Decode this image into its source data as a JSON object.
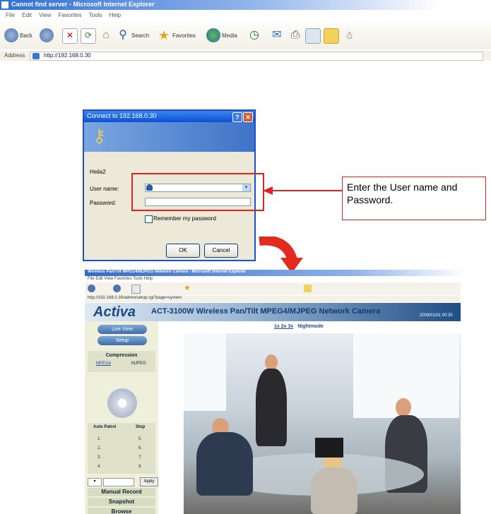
{
  "ie": {
    "title": "Cannot find server - Microsoft Internet Explorer",
    "menu": [
      "File",
      "Edit",
      "View",
      "Favorites",
      "Tools",
      "Help"
    ],
    "toolbar": {
      "back": "Back",
      "search": "Search",
      "favorites": "Favorites",
      "media": "Media"
    },
    "address_label": "Address",
    "address_value": "http://192.168.0.30"
  },
  "login": {
    "title": "Connect to 192.168.0.30",
    "realm": "Heila2",
    "username_label": "User name:",
    "password_label": "Password:",
    "remember_label": "Remember my password",
    "ok": "OK",
    "cancel": "Cancel"
  },
  "callout": {
    "text": "Enter the User name and Password."
  },
  "camera": {
    "title": "Wireless Pan/Tilt MPEG4/MJPEG Network Camera - Microsoft Internet Explorer",
    "menu": "File  Edit  View  Favorites  Tools  Help",
    "address": "http://192.168.0.30/admin/setup.cgi?page=system",
    "logo": "Activa",
    "model": "ACT-3100W Wireless Pan/Tilt MPEG4/MJPEG Network Camera",
    "datetime": "2009/01/01 00:30",
    "live_view": "Live View",
    "setup": "Setup",
    "compression": "Compression",
    "mpeg4": "MPEG4",
    "mjpeg": "MJPEG",
    "auto_patrol": "Auto Patrol",
    "stop": "Stop",
    "presets": [
      "1.",
      "5.",
      "2.",
      "6.",
      "3.",
      "7.",
      "4.",
      "8."
    ],
    "apply": "Apply",
    "manual_record": "Manual Record",
    "snapshot": "Snapshot",
    "browse": "Browse",
    "zoom": "1x 2x 3x",
    "nightmode": "Nightmode"
  },
  "colors": {
    "accent_red": "#e0231f",
    "xp_blue": "#1c50c8",
    "activa_blue": "#1d4a82"
  }
}
